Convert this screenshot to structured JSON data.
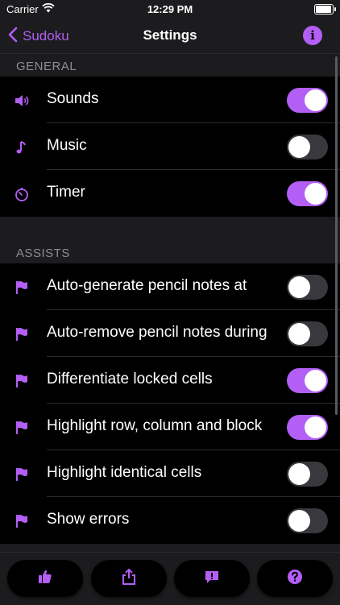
{
  "status_bar": {
    "carrier": "Carrier",
    "time": "12:29 PM"
  },
  "nav": {
    "back_label": "Sudoku",
    "title": "Settings",
    "info_glyph": "i"
  },
  "accent_color": "#b35ef5",
  "general": {
    "header": "GENERAL",
    "items": [
      {
        "label": "Sounds",
        "icon": "speaker-icon",
        "on": true
      },
      {
        "label": "Music",
        "icon": "music-note-icon",
        "on": false
      },
      {
        "label": "Timer",
        "icon": "timer-icon",
        "on": true
      }
    ]
  },
  "assists": {
    "header": "ASSISTS",
    "items": [
      {
        "label": "Auto-generate pencil notes at",
        "icon": "flag-icon",
        "on": false
      },
      {
        "label": "Auto-remove pencil notes during",
        "icon": "flag-icon",
        "on": false
      },
      {
        "label": "Differentiate locked cells",
        "icon": "flag-icon",
        "on": true
      },
      {
        "label": "Highlight row, column and block",
        "icon": "flag-icon",
        "on": true
      },
      {
        "label": "Highlight identical cells",
        "icon": "flag-icon",
        "on": false
      },
      {
        "label": "Show errors",
        "icon": "flag-icon",
        "on": false
      }
    ]
  },
  "tab_bar": [
    {
      "icon": "thumbs-up-icon"
    },
    {
      "icon": "share-icon"
    },
    {
      "icon": "feedback-icon"
    },
    {
      "icon": "help-icon"
    }
  ]
}
